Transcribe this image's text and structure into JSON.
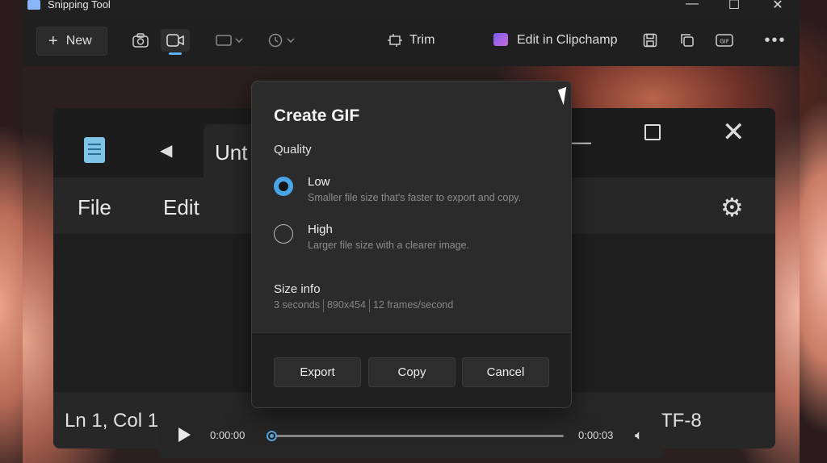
{
  "app": {
    "title": "Snipping Tool",
    "window_controls": [
      "—",
      "☐",
      "✕"
    ]
  },
  "toolbar": {
    "new_label": "New",
    "trim_label": "Trim",
    "clipchamp_label": "Edit in Clipchamp"
  },
  "notepad": {
    "tab_title": "Unt",
    "menu_file": "File",
    "menu_edit": "Edit",
    "status_position": "Ln 1, Col 1",
    "status_encoding": "TF-8"
  },
  "player": {
    "current_time": "0:00:00",
    "duration": "0:00:03",
    "progress": 0.0
  },
  "dialog": {
    "title": "Create GIF",
    "quality_label": "Quality",
    "options": [
      {
        "label": "Low",
        "description": "Smaller file size that's faster to export and copy.",
        "selected": true
      },
      {
        "label": "High",
        "description": "Larger file size with a clearer image.",
        "selected": false
      }
    ],
    "size_info_title": "Size info",
    "size_info": [
      "3 seconds",
      "890x454",
      "12 frames/second"
    ],
    "buttons": {
      "export": "Export",
      "copy": "Copy",
      "cancel": "Cancel"
    }
  },
  "colors": {
    "accent": "#4aa5e8",
    "dialog_bg": "#2b2b2b",
    "footer_bg": "#202020"
  }
}
